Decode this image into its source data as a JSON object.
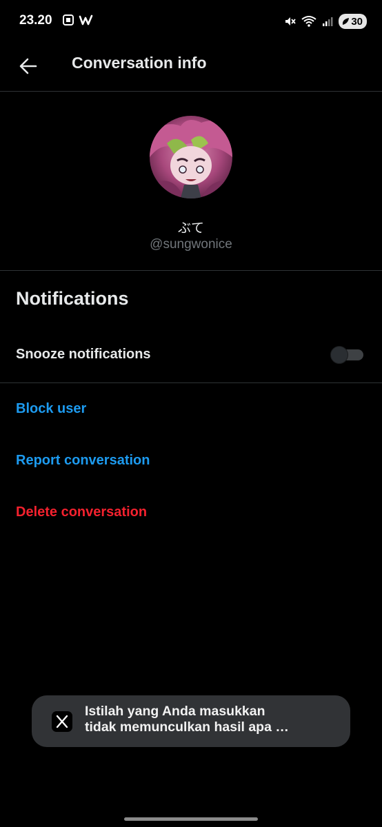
{
  "status_bar": {
    "time": "23.20",
    "battery": "30"
  },
  "header": {
    "title": "Conversation info"
  },
  "profile": {
    "display_name": "ぶて",
    "handle": "@sungwonice"
  },
  "notifications": {
    "title": "Notifications",
    "snooze_label": "Snooze notifications",
    "snooze_enabled": false
  },
  "actions": {
    "block": "Block user",
    "report": "Report conversation",
    "delete": "Delete conversation"
  },
  "toast": {
    "line1": "Istilah yang Anda masukkan",
    "line2": "tidak memunculkan hasil apa …"
  },
  "colors": {
    "background": "#000000",
    "text_primary": "#e7e9ea",
    "text_secondary": "#71767b",
    "link_blue": "#1d9bf0",
    "danger_red": "#f4212e",
    "divider": "#2f3336"
  },
  "icons": {
    "back": "arrow-left-icon",
    "toast_app": "x-logo-icon"
  }
}
